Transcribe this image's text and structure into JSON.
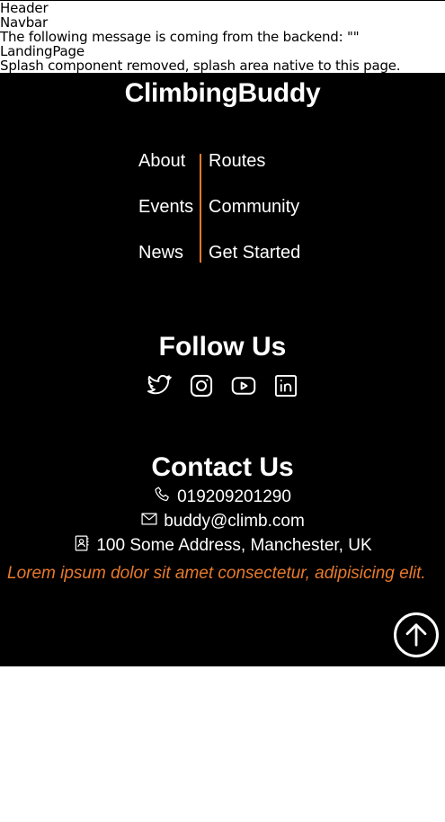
{
  "debug": {
    "header": "Header",
    "navbar": "Navbar",
    "backend_message": "The following message is coming from the backend: \"\"",
    "landing": "LandingPage",
    "splash_note": "Splash component removed, splash area native to this page."
  },
  "footer": {
    "brand": "ClimbingBuddy",
    "nav_left": [
      "About",
      "Events",
      "News"
    ],
    "nav_right": [
      "Routes",
      "Community",
      "Get Started"
    ],
    "follow_title": "Follow Us",
    "social_icons": [
      "twitter-icon",
      "instagram-icon",
      "youtube-icon",
      "linkedin-icon"
    ],
    "contact_title": "Contact Us",
    "phone": "019209201290",
    "email": "buddy@climb.com",
    "address": "100 Some Address, Manchester, UK",
    "lorem": "Lorem ipsum dolor sit amet consectetur, adipisicing elit.",
    "back_to_top_icon": "arrow-up-circle-icon"
  },
  "colors": {
    "background": "#000000",
    "accent": "#e87a2c",
    "text": "#ffffff"
  }
}
